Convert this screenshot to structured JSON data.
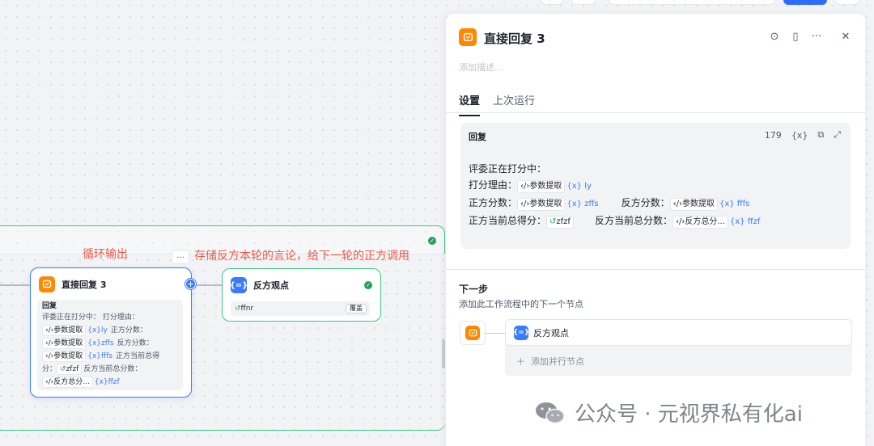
{
  "loop_annotation": "循环输出",
  "edge_annotation": "存储反方本轮的言论，给下一轮的正方调用",
  "more_label": "...",
  "node_reply": {
    "title": "直接回复 3",
    "body_label": "回复",
    "line1": "评委正在打分中：  打分理由：",
    "tag_extract": "参数提取",
    "var_ly": "ly",
    "text_zhengfang_score": "正方分数：",
    "var_zffs": "zffs",
    "text_fanfang_score": "反方分数：",
    "var_fffs": "fffs",
    "text_zhengfang_total_a": "正方当前总得",
    "text_zhengfang_total_b": "分：",
    "var_zfzf": "zfzf",
    "text_fanfang_total": "反方当前总分数：",
    "tag_fanfang_total": "反方总分...",
    "var_ffzf": "ffzf"
  },
  "node_opinion": {
    "title": "反方观点",
    "var": "ffnr",
    "chip": "覆盖"
  },
  "panel": {
    "title": "直接回复 3",
    "description_placeholder": "添加描述...",
    "tabs": [
      "设置",
      "上次运行"
    ],
    "reply_label": "回复",
    "char_count": "179",
    "var_icon_text": "{x}",
    "text_line1": "评委正在打分中：",
    "text_reason": "打分理由：",
    "tag_extract": "参数提取",
    "var_ly": "{x} ly",
    "text_zf_score": "正方分数：",
    "var_zffs": "{x} zffs",
    "text_ff_score": "反方分数：",
    "var_fffs": "{x} fffs",
    "text_zf_total": "正方当前总得分：",
    "var_zfzf": "zfzf",
    "text_ff_total": "反方当前总分数：",
    "tag_ff_total": "反方总分...",
    "var_ffzf": "{x} ffzf",
    "next_heading": "下一步",
    "next_desc": "添加此工作流程中的下一个节点",
    "next_node": "反方观点",
    "add_parallel": "添加并行节点"
  },
  "watermark": "公众号 · 元视界私有化ai",
  "colors": {
    "accent": "#3a7afe",
    "success": "#3fc783",
    "annotation": "#f2574a",
    "node_icon": "#ff8800"
  }
}
